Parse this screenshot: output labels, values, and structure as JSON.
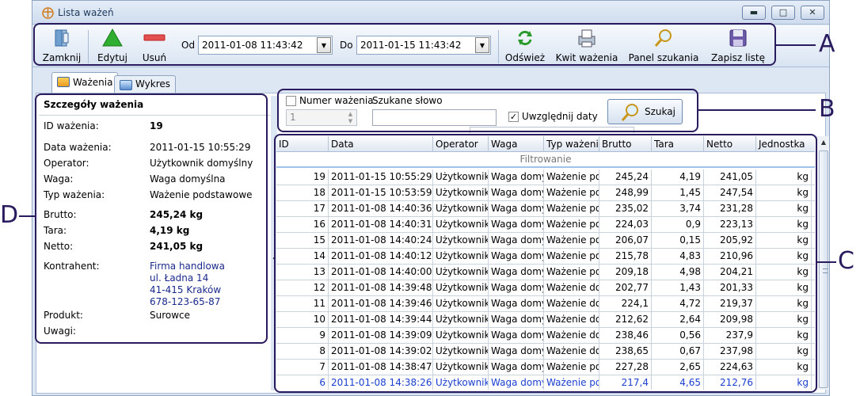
{
  "window": {
    "title": "Lista ważeń",
    "minimize": "▬",
    "maximize": "□",
    "close": "✕"
  },
  "toolbar": {
    "zamknij": "Zamknij",
    "edytuj": "Edytuj",
    "usun": "Usuń",
    "od_label": "Od",
    "od_value": "2011-01-08 11:43:42",
    "do_label": "Do",
    "do_value": "2011-01-15 11:43:42",
    "odswiez": "Odśwież",
    "kwit": "Kwit ważenia",
    "panel": "Panel szukania",
    "zapisz": "Zapisz listę"
  },
  "tabs": [
    {
      "label": "Ważenia"
    },
    {
      "label": "Wykres"
    }
  ],
  "details": {
    "title": "Szczegóły ważenia",
    "rows": [
      {
        "label": "ID ważenia:",
        "value": "19"
      },
      {
        "label": "Data ważenia:",
        "value": "2011-01-15 10:55:29"
      },
      {
        "label": "Operator:",
        "value": "Użytkownik domyślny"
      },
      {
        "label": "Waga:",
        "value": "Waga domyślna"
      },
      {
        "label": "Typ ważenia:",
        "value": "Ważenie podstawowe"
      },
      {
        "label": "Brutto:",
        "value": "245,24 kg"
      },
      {
        "label": "Tara:",
        "value": "4,19 kg"
      },
      {
        "label": "Netto:",
        "value": "241,05 kg"
      },
      {
        "label": "Kontrahent:",
        "value": "Firma handlowa"
      },
      {
        "label": "Produkt:",
        "value": "Surowce"
      },
      {
        "label": "Uwagi:",
        "value": ""
      }
    ],
    "kontrahent_lines": [
      "Firma handlowa",
      "ul. Ładna 14",
      "41-415 Kraków",
      "678-123-65-87"
    ]
  },
  "filter": {
    "numer_label": "Numer ważenia",
    "numer_value": "1",
    "szukane_label": "Szukane słowo",
    "szukane_value": "",
    "uwzglednij_label": "Uwzględnij daty",
    "uwzglednij_checked": true,
    "szukaj": "Szukaj"
  },
  "grid": {
    "columns": [
      "ID",
      "Data",
      "Operator",
      "Waga",
      "Typ ważenia",
      "Brutto",
      "Tara",
      "Netto",
      "Jednostka"
    ],
    "filter_text": "Filtrowanie",
    "rows": [
      [
        "19",
        "2011-01-15 10:55:29",
        "Użytkownik domyślny",
        "Waga domyślna",
        "Ważenie podstawowe",
        "245,24",
        "4,19",
        "241,05",
        "kg"
      ],
      [
        "18",
        "2011-01-15 10:53:59",
        "Użytkownik domyślny",
        "Waga domyślna",
        "Ważenie podstawowe",
        "248,99",
        "1,45",
        "247,54",
        "kg"
      ],
      [
        "17",
        "2011-01-08 14:40:36",
        "Użytkownik domyślny",
        "Waga domyślna",
        "Ważenie podstawowe",
        "235,02",
        "3,74",
        "231,28",
        "kg"
      ],
      [
        "16",
        "2011-01-08 14:40:31",
        "Użytkownik domyślny",
        "Waga domyślna",
        "Ważenie podstawowe",
        "224,03",
        "0,9",
        "223,13",
        "kg"
      ],
      [
        "15",
        "2011-01-08 14:40:24",
        "Użytkownik domyślny",
        "Waga domyślna",
        "Ważenie podstawowe",
        "206,07",
        "0,15",
        "205,92",
        "kg"
      ],
      [
        "14",
        "2011-01-08 14:40:12",
        "Użytkownik domyślny",
        "Waga domyślna",
        "Ważenie podstawowe",
        "215,78",
        "4,83",
        "210,96",
        "kg"
      ],
      [
        "13",
        "2011-01-08 14:40:00",
        "Użytkownik domyślny",
        "Waga domyślna",
        "Ważenie podstawowe",
        "209,18",
        "4,98",
        "204,21",
        "kg"
      ],
      [
        "12",
        "2011-01-08 14:39:48",
        "Użytkownik domyślny",
        "Waga domyślna",
        "Ważenie dorywcze",
        "202,77",
        "1,43",
        "201,33",
        "kg"
      ],
      [
        "11",
        "2011-01-08 14:39:46",
        "Użytkownik domyślny",
        "Waga domyślna",
        "Ważenie dorywcze",
        "224,1",
        "4,72",
        "219,37",
        "kg"
      ],
      [
        "10",
        "2011-01-08 14:39:44",
        "Użytkownik domyślny",
        "Waga domyślna",
        "Ważenie dorywcze",
        "212,62",
        "2,64",
        "209,98",
        "kg"
      ],
      [
        "9",
        "2011-01-08 14:39:09",
        "Użytkownik domyślny",
        "Waga domyślna",
        "Ważenie dorywcze",
        "238,46",
        "0,56",
        "237,9",
        "kg"
      ],
      [
        "8",
        "2011-01-08 14:39:02",
        "Użytkownik domyślny",
        "Waga domyślna",
        "Ważenie dorywcze",
        "238,65",
        "0,67",
        "237,98",
        "kg"
      ],
      [
        "7",
        "2011-01-08 14:38:47",
        "Użytkownik domyślny",
        "Waga domyślna",
        "Ważenie podstawowe",
        "227,28",
        "2,65",
        "224,63",
        "kg"
      ],
      [
        "6",
        "2011-01-08 14:38:26",
        "Użytkownik domyślny",
        "Waga domyślna",
        "Ważenie podstawowe",
        "217,4",
        "4,65",
        "212,76",
        "kg"
      ]
    ]
  },
  "callouts": {
    "a": "A",
    "b": "B",
    "c": "C",
    "d": "D"
  },
  "colors": {
    "accent": "#2a1a5e",
    "selected_row_text": "#1b3fd0"
  }
}
